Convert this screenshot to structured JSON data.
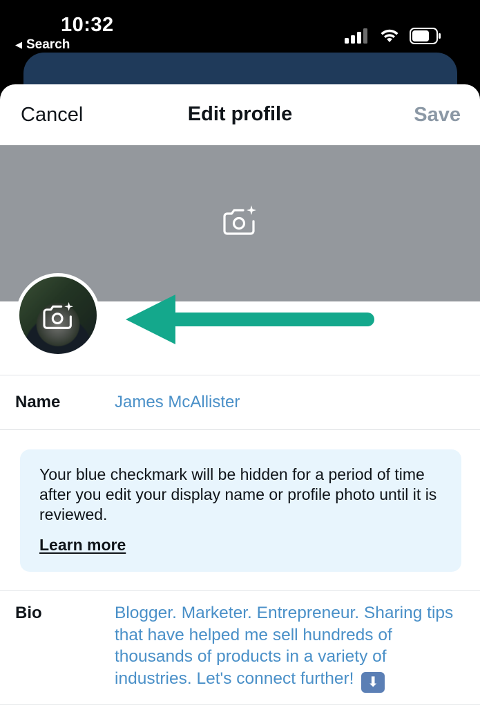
{
  "status_bar": {
    "time": "10:32",
    "back_label": "Search",
    "back_icon": "triangle-left-icon",
    "signal_icon": "cellular-signal-icon",
    "wifi_icon": "wifi-icon",
    "battery_icon": "battery-icon"
  },
  "nav": {
    "cancel_label": "Cancel",
    "title": "Edit profile",
    "save_label": "Save"
  },
  "banner": {
    "camera_icon": "camera-add-icon"
  },
  "avatar": {
    "camera_icon": "camera-add-icon"
  },
  "annotation": {
    "arrow_color": "#14a88c"
  },
  "name_row": {
    "label": "Name",
    "value": "James McAllister"
  },
  "notice": {
    "text": "Your blue checkmark will be hidden for a period of time after you edit your display name or profile photo until it is reviewed.",
    "link": "Learn more"
  },
  "bio_row": {
    "label": "Bio",
    "value": "Blogger. Marketer. Entrepreneur. Sharing tips that have helped me sell hundreds of thousands of products in a variety of industries. Let's connect further!",
    "emoji": "⬇️"
  },
  "colors": {
    "link_blue": "#4a90c8",
    "notice_bg": "#e8f5fd",
    "banner_gray": "#94989d",
    "save_disabled": "#8b98a5"
  }
}
